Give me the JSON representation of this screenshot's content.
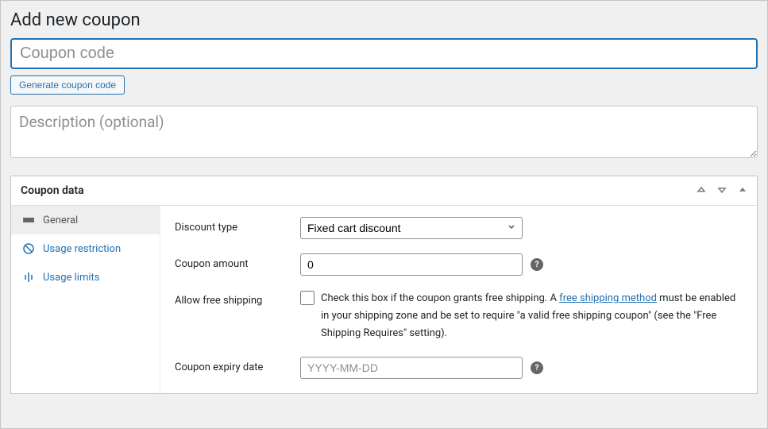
{
  "page": {
    "title": "Add new coupon"
  },
  "coupon_code": {
    "placeholder": "Coupon code"
  },
  "generate_button": {
    "label": "Generate coupon code"
  },
  "description": {
    "placeholder": "Description (optional)"
  },
  "panel": {
    "title": "Coupon data"
  },
  "tabs": {
    "general": "General",
    "usage_restriction": "Usage restriction",
    "usage_limits": "Usage limits"
  },
  "fields": {
    "discount_type": {
      "label": "Discount type",
      "value": "Fixed cart discount"
    },
    "coupon_amount": {
      "label": "Coupon amount",
      "value": "0"
    },
    "allow_free_shipping": {
      "label": "Allow free shipping",
      "desc_prefix": "Check this box if the coupon grants free shipping. A ",
      "link_text": "free shipping method",
      "desc_suffix": " must be enabled in your shipping zone and be set to require \"a valid free shipping coupon\" (see the \"Free Shipping Requires\" setting)."
    },
    "expiry_date": {
      "label": "Coupon expiry date",
      "placeholder": "YYYY-MM-DD"
    }
  },
  "help_tooltip": "?"
}
